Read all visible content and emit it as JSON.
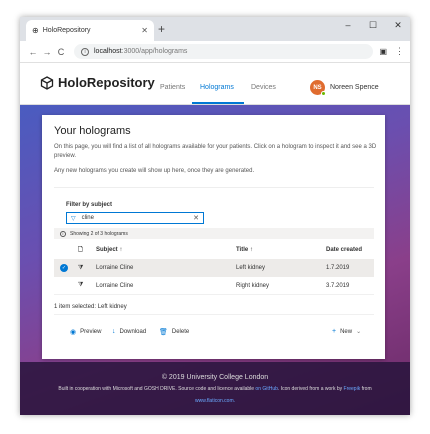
{
  "browser": {
    "tab_title": "HoloRepository",
    "tab_close": "✕",
    "new_tab": "+",
    "minimize": "–",
    "maximize": "☐",
    "close": "✕",
    "back": "←",
    "forward": "→",
    "reload": "C",
    "url_host": "localhost",
    "url_path": ":3000/app/holograms",
    "menu": "⋮"
  },
  "header": {
    "app_name": "HoloRepository",
    "nav": [
      {
        "label": "Patients"
      },
      {
        "label": "Holograms"
      },
      {
        "label": "Devices"
      }
    ],
    "user_initials": "NS",
    "user_name": "Noreen Spence"
  },
  "page": {
    "title": "Your holograms",
    "description": "On this page, you will find a list of all holograms available for your patients. Click on a hologram to inspect it and see a 3D preview.",
    "description2": "Any new holograms you create will show up here, once they are generated.",
    "filter_label": "Filter by subject",
    "filter_value": "cline",
    "showing_text": "Showing 2 of 3 holograms",
    "columns": {
      "subject": "Subject ↑",
      "title": "Title ↑",
      "date": "Date created"
    },
    "rows": [
      {
        "subject": "Lorraine Cline",
        "title": "Left kidney",
        "date": "1.7.2019",
        "selected": true
      },
      {
        "subject": "Lorraine Cline",
        "title": "Right kidney",
        "date": "3.7.2019",
        "selected": false
      }
    ],
    "selection_info": "1 item selected: Left kidney",
    "actions": {
      "preview": "Preview",
      "download": "Download",
      "delete": "Delete",
      "new": "New"
    }
  },
  "footer": {
    "copyright": "© 2019 University College London",
    "credits_prefix": "Built in cooperation with Microsoft and GOSH DRIVE. Source code and licence available",
    "credits_link1": "on GitHub",
    "credits_middle": ". Icon derived from a work by",
    "credits_link2": "Freepik",
    "credits_suffix": "from",
    "credits_site": "www.flaticon.com."
  },
  "colors": {
    "accent": "#0078d4",
    "avatar": "#e06c2f"
  }
}
